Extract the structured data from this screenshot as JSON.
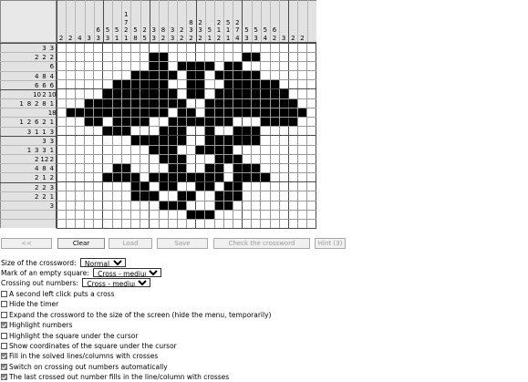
{
  "puzzle": {
    "rows": 20,
    "cols": 28,
    "col_clues": [
      [
        "2"
      ],
      [
        "2"
      ],
      [
        "4"
      ],
      [
        "3"
      ],
      [
        "6",
        "3"
      ],
      [
        "5",
        "3"
      ],
      [
        "5",
        "1"
      ],
      [
        "1",
        "7",
        "2",
        "1"
      ],
      [
        "5",
        "8"
      ],
      [
        "2",
        "5"
      ],
      [
        "3",
        "3"
      ],
      [
        "8",
        "2"
      ],
      [
        "3",
        "3"
      ],
      [
        "2",
        "2"
      ],
      [
        "8",
        "3",
        "2"
      ],
      [
        "2",
        "3",
        "2"
      ],
      [
        "5",
        "1"
      ],
      [
        "2",
        "1",
        "2"
      ],
      [
        "5",
        "1",
        "1"
      ],
      [
        "2",
        "7",
        "4"
      ],
      [
        "5",
        "3"
      ],
      [
        "5",
        "3"
      ],
      [
        "5",
        "4"
      ],
      [
        "6",
        "2"
      ],
      [
        "3"
      ],
      [
        "2"
      ],
      [
        "2"
      ],
      []
    ],
    "row_clues": [
      [
        "3",
        "3"
      ],
      [
        "2",
        "2",
        "2"
      ],
      [
        "6"
      ],
      [
        "4",
        "8",
        "4"
      ],
      [
        "6",
        "6",
        "6"
      ],
      [
        "10",
        "2",
        "10"
      ],
      [
        "1",
        "8",
        "2",
        "8",
        "1"
      ],
      [
        "18"
      ],
      [
        "1",
        "2",
        "6",
        "2",
        "1"
      ],
      [
        "3",
        "1",
        "1",
        "3"
      ],
      [
        "3",
        "3"
      ],
      [
        "1",
        "3",
        "3",
        "1"
      ],
      [
        "2",
        "12",
        "2"
      ],
      [
        "4",
        "8",
        "4"
      ],
      [
        "2",
        "1",
        "2"
      ],
      [
        "2",
        "2",
        "3"
      ],
      [
        "2",
        "2",
        "1"
      ],
      [
        "3"
      ],
      [],
      []
    ],
    "solution": [
      "............................",
      "..........##........##......",
      "..........##.####.##........",
      "........#####.##.#####......",
      "......######..##..######....",
      ".....########.##.########...",
      "...###########..##########..",
      ".###########.##.###########.",
      "...##.####..#######...####..",
      ".....###...###..#..###......",
      "........######..######......",
      "..........###..####.........",
      "...........###...###........",
      "......##....##..##.###......",
      ".....####.########.####.....",
      "........##.##..##.##........",
      "........###..##..###........",
      "...........###...##.........",
      "..............###...........",
      "............................"
    ]
  },
  "buttons": {
    "prev": "<<",
    "clear": "Clear",
    "load": "Load",
    "save": "Save",
    "check": "Check the crossword",
    "hint": "Hint (3)"
  },
  "options": {
    "size_label": "Size of the crossword:",
    "size_value": "Normal",
    "mark_label": "Mark of an empty square:",
    "mark_value": "Cross - medium",
    "crossing_label": "Crossing out numbers:",
    "crossing_value": "Cross - medium",
    "checkboxes": [
      {
        "label": "A second left click puts a cross",
        "checked": false
      },
      {
        "label": "Hide the timer",
        "checked": false
      },
      {
        "label": "Expand the crossword to the size of the screen (hide the menu, temporarily)",
        "checked": false
      },
      {
        "label": "Highlight numbers",
        "checked": true
      },
      {
        "label": "Highlight the square under the cursor",
        "checked": false
      },
      {
        "label": "Show coordinates of the square under the cursor",
        "checked": false
      },
      {
        "label": "Fill in the solved lines/columns with crosses",
        "checked": true
      },
      {
        "label": "Switch on crossing out numbers automatically",
        "checked": true
      },
      {
        "label": "The last crossed out number fills in the line/column with crosses",
        "checked": true
      }
    ]
  },
  "colors": {
    "filled": "#000000",
    "clue_bg": "#e2e2e2",
    "grid_line": "#9a9a9a",
    "thick_line": "#4a4a4a"
  }
}
